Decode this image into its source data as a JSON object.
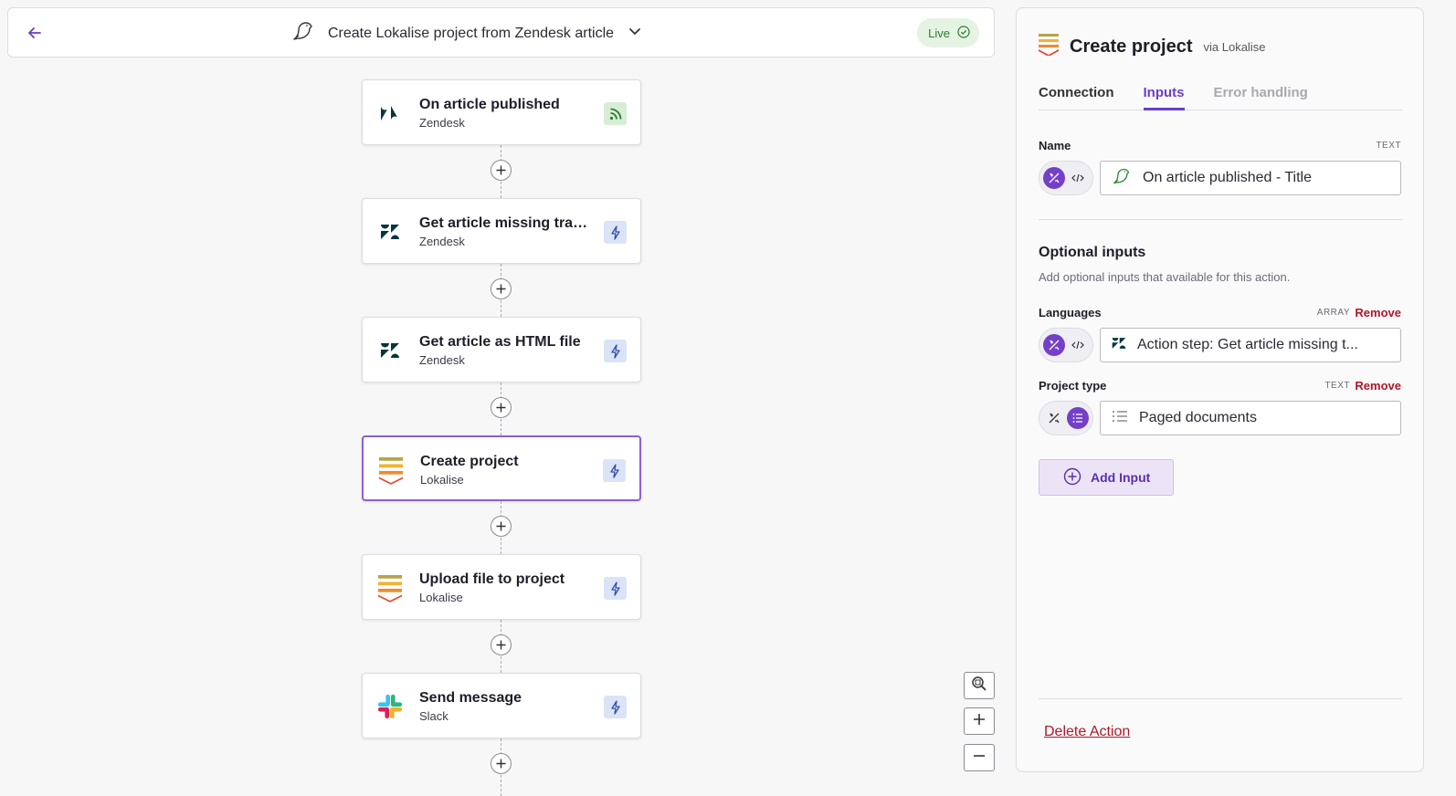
{
  "header": {
    "workflow_title": "Create Lokalise project from Zendesk article",
    "status_badge": "Live"
  },
  "steps": [
    {
      "name": "On article published",
      "app": "Zendesk",
      "kind": "trigger"
    },
    {
      "name": "Get article missing tran...",
      "app": "Zendesk",
      "kind": "action"
    },
    {
      "name": "Get article as HTML file",
      "app": "Zendesk",
      "kind": "action"
    },
    {
      "name": "Create project",
      "app": "Lokalise",
      "kind": "action"
    },
    {
      "name": "Upload file to project",
      "app": "Lokalise",
      "kind": "action"
    },
    {
      "name": "Send message",
      "app": "Slack",
      "kind": "action"
    }
  ],
  "panel": {
    "title": "Create project",
    "via": "via Lokalise",
    "tabs": [
      "Connection",
      "Inputs",
      "Error handling"
    ],
    "name_field": {
      "label": "Name",
      "type": "TEXT",
      "value": "On article published - Title"
    },
    "optional": {
      "title": "Optional inputs",
      "subtitle": "Add optional inputs that available for this action."
    },
    "languages_field": {
      "label": "Languages",
      "type": "ARRAY",
      "remove": "Remove",
      "value": "Action step: Get article missing t..."
    },
    "project_type_field": {
      "label": "Project type",
      "type": "TEXT",
      "remove": "Remove",
      "value": "Paged documents"
    },
    "add_input": "Add Input",
    "delete_action": "Delete Action"
  },
  "colors": {
    "accent": "#6a3fc4",
    "danger": "#b0172a",
    "live_bg": "#e5f3e3",
    "live_fg": "#2c7a33"
  }
}
